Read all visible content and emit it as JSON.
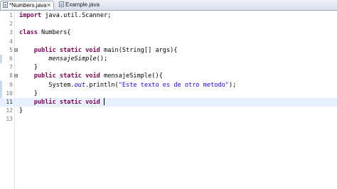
{
  "tabs": [
    {
      "label": "*Numbers.java",
      "close": "✕",
      "active": true
    },
    {
      "label": "Example.java",
      "active": false
    }
  ],
  "editor": {
    "lines": [
      {
        "num": "1",
        "parts": [
          {
            "t": "import",
            "c": "kw"
          },
          {
            "t": " java.util.Scanner;"
          }
        ]
      },
      {
        "num": "2",
        "parts": []
      },
      {
        "num": "3",
        "parts": [
          {
            "t": "class",
            "c": "kw"
          },
          {
            "t": " Numbers{"
          }
        ]
      },
      {
        "num": "4",
        "parts": []
      },
      {
        "num": "5",
        "fold": true,
        "parts": [
          {
            "t": "    "
          },
          {
            "t": "public static void",
            "c": "kw"
          },
          {
            "t": " main(String[] args){"
          }
        ]
      },
      {
        "num": "6",
        "marked": true,
        "parts": [
          {
            "t": "        "
          },
          {
            "t": "mensajeSimple",
            "c": "static-call"
          },
          {
            "t": "();"
          }
        ]
      },
      {
        "num": "7",
        "parts": [
          {
            "t": "    }"
          }
        ]
      },
      {
        "num": "8",
        "fold": true,
        "parts": [
          {
            "t": "    "
          },
          {
            "t": "public static void",
            "c": "kw"
          },
          {
            "t": " mensajeSimple(){"
          }
        ]
      },
      {
        "num": "9",
        "marked": true,
        "parts": [
          {
            "t": "        System."
          },
          {
            "t": "out",
            "c": "field"
          },
          {
            "t": ".println("
          },
          {
            "t": "\"Este texto es de otro metodo\"",
            "c": "str"
          },
          {
            "t": ");"
          }
        ]
      },
      {
        "num": "10",
        "marked": true,
        "parts": [
          {
            "t": "    }"
          }
        ]
      },
      {
        "num": "11",
        "current": true,
        "parts": [
          {
            "t": "    "
          },
          {
            "t": "public static void",
            "c": "kw"
          },
          {
            "t": " "
          }
        ],
        "caret": true
      },
      {
        "num": "12",
        "parts": [
          {
            "t": "}"
          }
        ]
      },
      {
        "num": "13",
        "parts": []
      }
    ]
  }
}
